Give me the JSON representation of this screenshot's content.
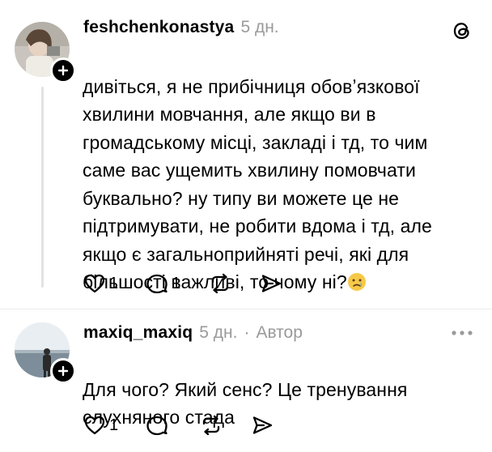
{
  "posts": [
    {
      "username": "feshchenkonastya",
      "time": "5 дн.",
      "text": "дивіться, я не прибічниця обовʼязкової\nхвилини мовчання, але якщо ви в\nгромадському місці, закладі і тд, то чим\nсаме вас ущемить хвилину помовчати\nбуквально? ну типу ви можете це не\nпідтримувати, не робити вдома і тд, але\nякщо є загальноприйняті речі, які для\nбільшості важливі, то чому ні?",
      "emoji": "crying-face-icon",
      "likes": "1",
      "replies": "1"
    },
    {
      "username": "maxiq_maxiq",
      "time": "5 дн.",
      "author_tag": "Автор",
      "text": "Для чого? Який сенс? Це тренування\nслухняного стада",
      "likes": "1",
      "replies": ""
    }
  ],
  "colors": {
    "text": "#000000",
    "meta": "#9a9a9a",
    "thread_line": "#e3e3e3"
  }
}
